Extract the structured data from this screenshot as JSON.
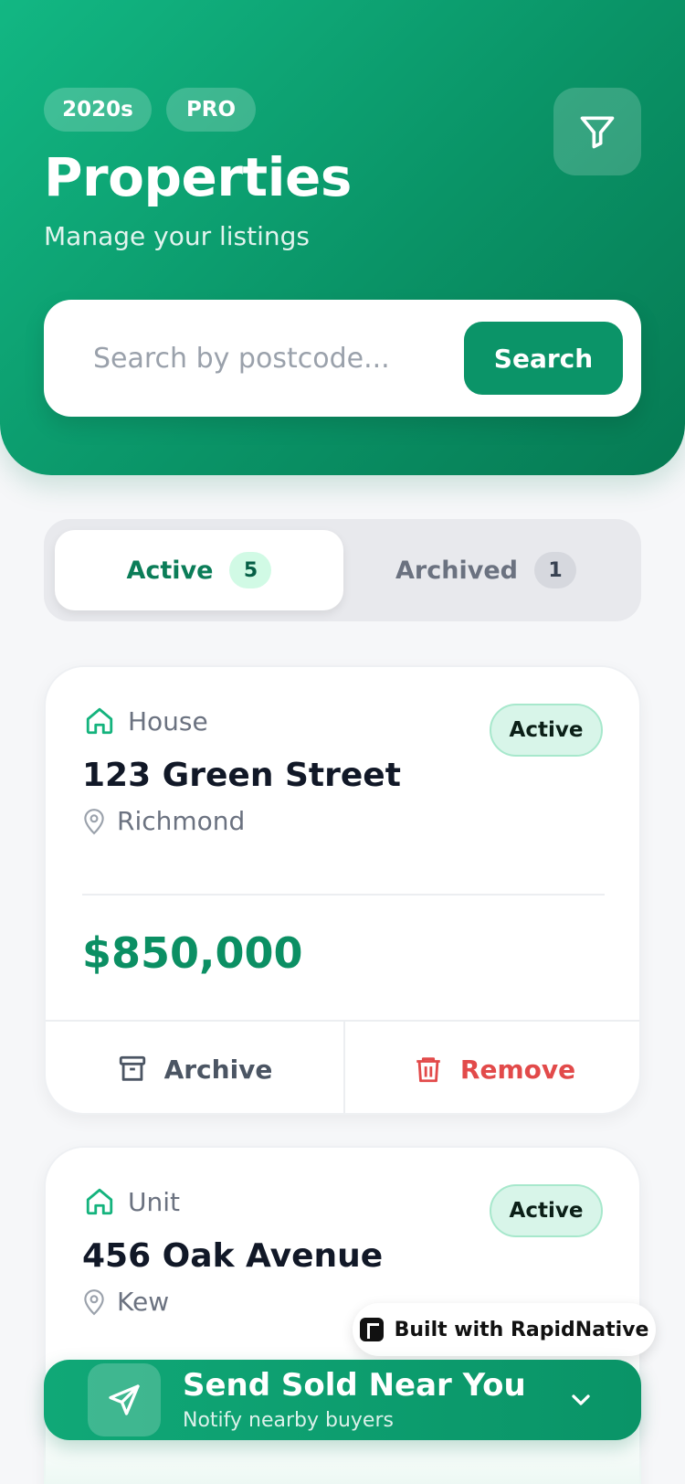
{
  "header": {
    "pills": [
      "2020s",
      "PRO"
    ],
    "title": "Properties",
    "subtitle": "Manage your listings"
  },
  "search": {
    "placeholder": "Search by postcode...",
    "value": "",
    "button_label": "Search"
  },
  "tabs": [
    {
      "label": "Active",
      "count": "5",
      "selected": true
    },
    {
      "label": "Archived",
      "count": "1",
      "selected": false
    }
  ],
  "cards": [
    {
      "type": "House",
      "status": "Active",
      "address": "123 Green Street",
      "suburb": "Richmond",
      "price": "$850,000",
      "actions": {
        "archive": "Archive",
        "remove": "Remove"
      }
    },
    {
      "type": "Unit",
      "status": "Active",
      "address": "456 Oak Avenue",
      "suburb": "Kew"
    }
  ],
  "badge_builder": {
    "label": "Built with RapidNative"
  },
  "banner": {
    "title": "Send Sold Near You",
    "subtitle": "Notify nearby buyers"
  },
  "colors": {
    "primary": "#0b9468",
    "danger": "#e24a4a",
    "active_badge_bg": "#d8f5e9"
  }
}
